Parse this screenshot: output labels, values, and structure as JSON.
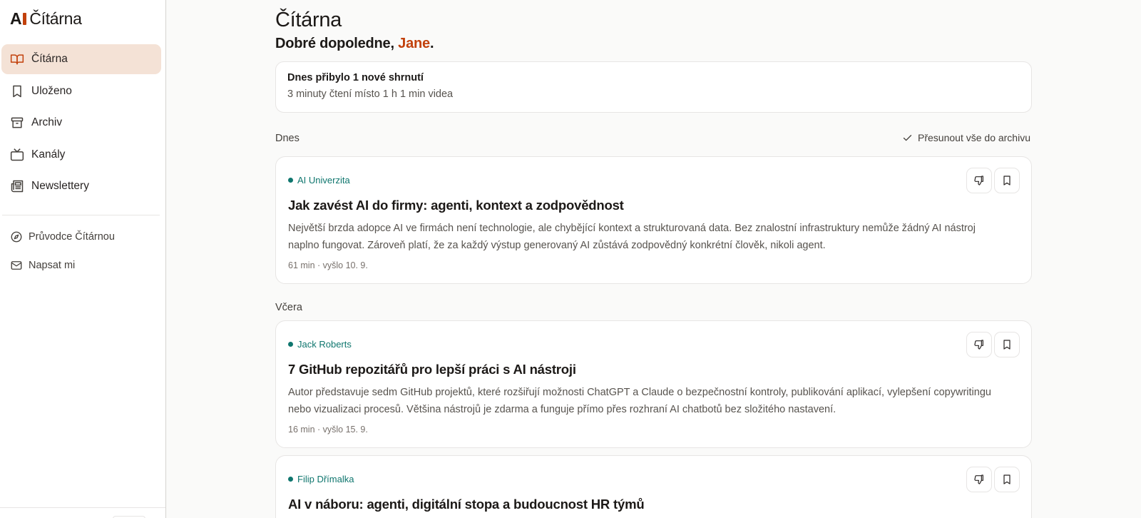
{
  "app": {
    "logo_a": "A",
    "logo_text": "Čítárna"
  },
  "sidebar": {
    "items": [
      {
        "label": "Čítárna",
        "icon": "open-book-icon",
        "active": true
      },
      {
        "label": "Uloženo",
        "icon": "bookmark-icon",
        "active": false
      },
      {
        "label": "Archiv",
        "icon": "archive-box-icon",
        "active": false
      },
      {
        "label": "Kanály",
        "icon": "tv-icon",
        "active": false
      },
      {
        "label": "Newslettery",
        "icon": "newspaper-icon",
        "active": false
      }
    ],
    "secondary": [
      {
        "label": "Průvodce Čítárnou",
        "icon": "compass-icon"
      },
      {
        "label": "Napsat mi",
        "icon": "mail-icon"
      }
    ]
  },
  "header": {
    "title": "Čítárna",
    "greeting_prefix": "Dobré dopoledne, ",
    "greeting_name": "Jane",
    "greeting_suffix": "."
  },
  "summary": {
    "headline": "Dnes přibylo 1 nové shrnutí",
    "detail": "3 minuty čtení místo 1 h 1 min videa"
  },
  "sections": {
    "today": "Dnes",
    "yesterday": "Včera",
    "archive_all": "Přesunout vše do archivu"
  },
  "cards": [
    {
      "source": "AI Univerzita",
      "title": "Jak zavést AI do firmy: agenti, kontext a zodpovědnost",
      "description": "Největší brzda adopce AI ve firmách není technologie, ale chybějící kontext a strukturovaná data. Bez znalostní infrastruktury nemůže žádný AI nástroj naplno fungovat. Zároveň platí, že za každý výstup generovaný AI zůstává zodpovědný konkrétní člověk, nikoli agent.",
      "meta": "61 min · vyšlo 10. 9."
    },
    {
      "source": "Jack Roberts",
      "title": "7 GitHub repozitářů pro lepší práci s AI nástroji",
      "description": "Autor představuje sedm GitHub projektů, které rozšiřují možnosti ChatGPT a Claude o bezpečnostní kontroly, publikování aplikací, vylepšení copywritingu nebo vizualizaci procesů. Většina nástrojů je zdarma a funguje přímo přes rozhraní AI chatbotů bez složitého nastavení.",
      "meta": "16 min · vyšlo 15. 9."
    },
    {
      "source": "Filip Dřímalka",
      "title": "AI v náboru: agenti, digitální stopa a budoucnost HR týmů",
      "description": "",
      "meta": ""
    }
  ],
  "colors": {
    "accent": "#c2410c",
    "active_bg": "#f4e2d6",
    "source_green": "#0f766e"
  }
}
